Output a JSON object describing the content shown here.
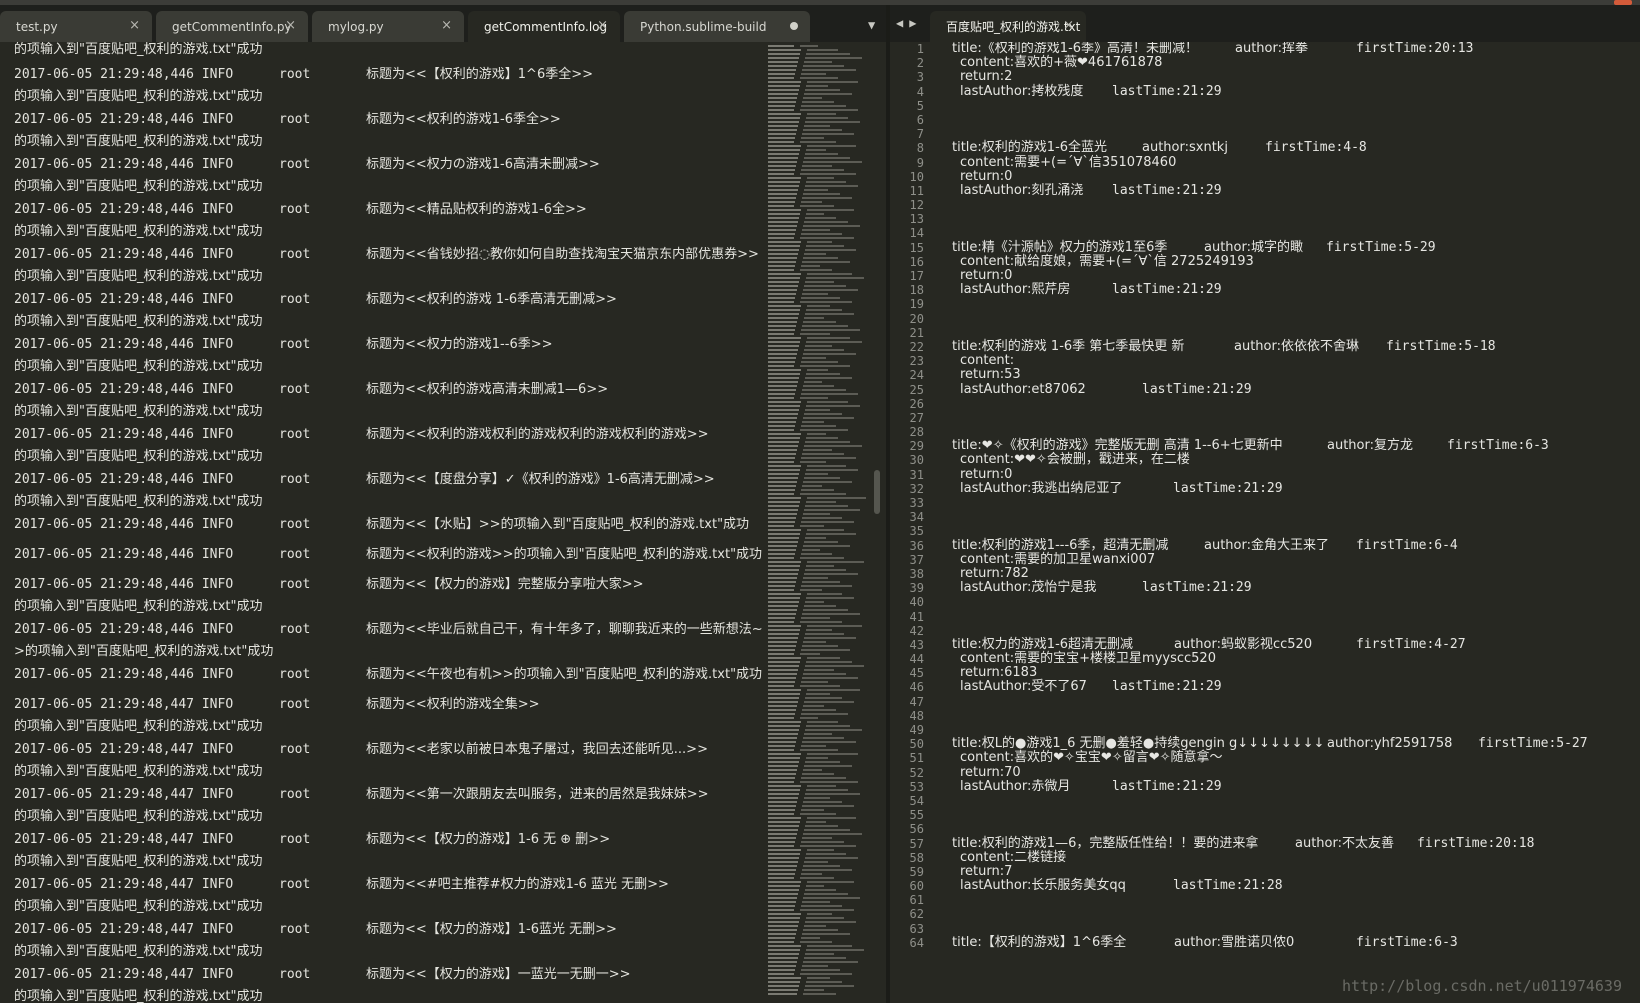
{
  "left_tabs": [
    {
      "label": "test.py",
      "state": "close"
    },
    {
      "label": "getCommentInfo.py",
      "state": "close"
    },
    {
      "label": "mylog.py",
      "state": "close"
    },
    {
      "label": "getCommentInfo.log",
      "state": "close",
      "active": true
    },
    {
      "label": "Python.sublime-build",
      "state": "dirty"
    }
  ],
  "right_tab": {
    "label": "百度贴吧_权利的游戏.txt"
  },
  "glyphs": {
    "close": "×",
    "dropdown": "▼",
    "nav": "◀▶"
  },
  "log_first_line": "的项输入到\"百度贴吧_权利的游戏.txt\"成功",
  "log_entries": [
    {
      "date": "2017-06-05 21:29:48,446 INFO",
      "user": "root",
      "msg": "标题为<<【权利的游戏】1^6季全>>",
      "cont": "的项输入到\"百度贴吧_权利的游戏.txt\"成功"
    },
    {
      "date": "2017-06-05 21:29:48,446 INFO",
      "user": "root",
      "msg": "标题为<<权利的游戏1-6季全>>",
      "cont": "的项输入到\"百度贴吧_权利的游戏.txt\"成功"
    },
    {
      "date": "2017-06-05 21:29:48,446 INFO",
      "user": "root",
      "msg": "标题为<<权力の游戏1-6高清未删减>>",
      "cont": "的项输入到\"百度贴吧_权利的游戏.txt\"成功"
    },
    {
      "date": "2017-06-05 21:29:48,446 INFO",
      "user": "root",
      "msg": "标题为<<精品贴权利的游戏1-6全>>",
      "cont": "的项输入到\"百度贴吧_权利的游戏.txt\"成功"
    },
    {
      "date": "2017-06-05 21:29:48,446 INFO",
      "user": "root",
      "msg": "标题为<<省钱妙招◌教你如何自助查找淘宝天猫京东内部优惠券>>",
      "cont": "的项输入到\"百度贴吧_权利的游戏.txt\"成功"
    },
    {
      "date": "2017-06-05 21:29:48,446 INFO",
      "user": "root",
      "msg": "标题为<<权利的游戏 1-6季高清无删减>>",
      "cont": "的项输入到\"百度贴吧_权利的游戏.txt\"成功"
    },
    {
      "date": "2017-06-05 21:29:48,446 INFO",
      "user": "root",
      "msg": "标题为<<权力的游戏1--6季>>",
      "cont": "的项输入到\"百度贴吧_权利的游戏.txt\"成功"
    },
    {
      "date": "2017-06-05 21:29:48,446 INFO",
      "user": "root",
      "msg": "标题为<<权利的游戏高清未删减1—6>>",
      "cont": "的项输入到\"百度贴吧_权利的游戏.txt\"成功"
    },
    {
      "date": "2017-06-05 21:29:48,446 INFO",
      "user": "root",
      "msg": "标题为<<权利的游戏权利的游戏权利的游戏权利的游戏>>",
      "cont": "的项输入到\"百度贴吧_权利的游戏.txt\"成功"
    },
    {
      "date": "2017-06-05 21:29:48,446 INFO",
      "user": "root",
      "msg": "标题为<<【度盘分享】✓《权利的游戏》1-6高清无删减>>",
      "cont": "的项输入到\"百度贴吧_权利的游戏.txt\"成功"
    },
    {
      "date": "2017-06-05 21:29:48,446 INFO",
      "user": "root",
      "msg": "标题为<<【水贴】>>的项输入到\"百度贴吧_权利的游戏.txt\"成功",
      "cont": ""
    },
    {
      "date": "2017-06-05 21:29:48,446 INFO",
      "user": "root",
      "msg": "标题为<<权利的游戏>>的项输入到\"百度贴吧_权利的游戏.txt\"成功",
      "cont": ""
    },
    {
      "date": "2017-06-05 21:29:48,446 INFO",
      "user": "root",
      "msg": "标题为<<【权力的游戏】完整版分享啦大家>>",
      "cont": "的项输入到\"百度贴吧_权利的游戏.txt\"成功"
    },
    {
      "date": "2017-06-05 21:29:48,446 INFO",
      "user": "root",
      "msg": "标题为<<毕业后就自己干，有十年多了，聊聊我近来的一些新想法~",
      "cont": ">的项输入到\"百度贴吧_权利的游戏.txt\"成功"
    },
    {
      "date": "2017-06-05 21:29:48,446 INFO",
      "user": "root",
      "msg": "标题为<<午夜也有机>>的项输入到\"百度贴吧_权利的游戏.txt\"成功",
      "cont": ""
    },
    {
      "date": "2017-06-05 21:29:48,447 INFO",
      "user": "root",
      "msg": "标题为<<权利的游戏全集>>",
      "cont": "的项输入到\"百度贴吧_权利的游戏.txt\"成功"
    },
    {
      "date": "2017-06-05 21:29:48,447 INFO",
      "user": "root",
      "msg": "标题为<<老家以前被日本鬼子屠过，我回去还能听见...>>",
      "cont": "的项输入到\"百度贴吧_权利的游戏.txt\"成功"
    },
    {
      "date": "2017-06-05 21:29:48,447 INFO",
      "user": "root",
      "msg": "标题为<<第一次跟朋友去叫服务，进来的居然是我妹妹>>",
      "cont": "的项输入到\"百度贴吧_权利的游戏.txt\"成功"
    },
    {
      "date": "2017-06-05 21:29:48,447 INFO",
      "user": "root",
      "msg": "标题为<<【权力的游戏】1-6  无 ⊕ 删>>",
      "cont": "的项输入到\"百度贴吧_权利的游戏.txt\"成功"
    },
    {
      "date": "2017-06-05 21:29:48,447 INFO",
      "user": "root",
      "msg": "标题为<<#吧主推荐#权力的游戏1-6 蓝光 无删>>",
      "cont": "的项输入到\"百度贴吧_权利的游戏.txt\"成功"
    },
    {
      "date": "2017-06-05 21:29:48,447 INFO",
      "user": "root",
      "msg": "标题为<<【权力的游戏】1-6蓝光 无删>>",
      "cont": "的项输入到\"百度贴吧_权利的游戏.txt\"成功"
    },
    {
      "date": "2017-06-05 21:29:48,447 INFO",
      "user": "root",
      "msg": "标题为<<【权力的游戏】一蓝光一无删一>>",
      "cont": "的项输入到\"百度贴吧_权利的游戏.txt\"成功"
    }
  ],
  "txt_lines": [
    {
      "n": "1",
      "title": "title:《权利的游戏1-6季》高清！未删减！",
      "author": "author:挥拳",
      "first": "firstTime:20:13"
    },
    {
      "n": "2",
      "content": "content:喜欢的+薇❤461761878"
    },
    {
      "n": "3",
      "content": "return:2"
    },
    {
      "n": "4",
      "la": "lastAuthor:拷枚残度",
      "lt": "lastTime:21:29"
    },
    {
      "n": "5"
    },
    {
      "n": "6"
    },
    {
      "n": "7"
    },
    {
      "n": "8",
      "title": "title:权利的游戏1-6全蓝光",
      "author": "author:sxntkj",
      "first": "firstTime:4-8"
    },
    {
      "n": "9",
      "content": "content:需要+(=´∀`信351078460"
    },
    {
      "n": "10",
      "content": "return:0"
    },
    {
      "n": "11",
      "la": "lastAuthor:刻孔涌浇",
      "lt": "lastTime:21:29"
    },
    {
      "n": "12"
    },
    {
      "n": "13"
    },
    {
      "n": "14"
    },
    {
      "n": "15",
      "title": "title:精《汁源帖》权力的游戏1至6季",
      "author": "author:城字的瞰",
      "first": "firstTime:5-29"
    },
    {
      "n": "16",
      "content": "content:献给度娘，需要+(=´∀`信 2725249193"
    },
    {
      "n": "17",
      "content": "return:0"
    },
    {
      "n": "18",
      "la": "lastAuthor:熙芹房",
      "lt": "lastTime:21:29"
    },
    {
      "n": "19"
    },
    {
      "n": "20"
    },
    {
      "n": "21"
    },
    {
      "n": "22",
      "title": "title:权利的游戏 1-6季 第七季最快更 新",
      "author": "author:依依依不舍琳",
      "first": "firstTime:5-18"
    },
    {
      "n": "23",
      "content": "content:"
    },
    {
      "n": "24",
      "content": "return:53"
    },
    {
      "n": "25",
      "la": "lastAuthor:et87062",
      "lt": "lastTime:21:29"
    },
    {
      "n": "26"
    },
    {
      "n": "27"
    },
    {
      "n": "28"
    },
    {
      "n": "29",
      "title": "title:❤✧《权利的游戏》完整版无删 高清 1--6+七更新中",
      "author": "author:复方龙",
      "first": "firstTime:6-3"
    },
    {
      "n": "30",
      "content": "content:❤❤✧会被删，戳进来，在二楼"
    },
    {
      "n": "31",
      "content": "return:0"
    },
    {
      "n": "32",
      "la": "lastAuthor:我逃出纳尼亚了",
      "lt": "lastTime:21:29"
    },
    {
      "n": "33"
    },
    {
      "n": "34"
    },
    {
      "n": "35"
    },
    {
      "n": "36",
      "title": "title:权利的游戏1---6季，超清无删减",
      "author": "author:金角大王来了",
      "first": "firstTime:6-4"
    },
    {
      "n": "37",
      "content": "content:需要的加卫星wanxi007"
    },
    {
      "n": "38",
      "content": "return:782"
    },
    {
      "n": "39",
      "la": "lastAuthor:茂怡宁是我",
      "lt": "lastTime:21:29"
    },
    {
      "n": "40"
    },
    {
      "n": "41"
    },
    {
      "n": "42"
    },
    {
      "n": "43",
      "title": "title:权力的游戏1-6超清无删减",
      "author": "author:蚂蚁影视cc520",
      "first": "firstTime:4-27"
    },
    {
      "n": "44",
      "content": "content:需要的宝宝+楼楼卫星myyscc520"
    },
    {
      "n": "45",
      "content": "return:6183"
    },
    {
      "n": "46",
      "la": "lastAuthor:受不了67",
      "lt": "lastTime:21:29"
    },
    {
      "n": "47"
    },
    {
      "n": "48"
    },
    {
      "n": "49"
    },
    {
      "n": "50",
      "title": "title:权L的●游戏1_6 无删●羞轻●持续gengin g↓↓↓↓↓↓↓↓",
      "author": "author:yhf2591758",
      "first": "firstTime:5-27"
    },
    {
      "n": "51",
      "content": "content:喜欢的❤✧宝宝❤✧留言❤✧随意拿～"
    },
    {
      "n": "52",
      "content": "return:70"
    },
    {
      "n": "53",
      "la": "lastAuthor:赤微月",
      "lt": "lastTime:21:29"
    },
    {
      "n": "54"
    },
    {
      "n": "55"
    },
    {
      "n": "56"
    },
    {
      "n": "57",
      "title": "title:权利的游戏1—6，完整版任性给！！要的进来拿",
      "author": "author:不太友善",
      "first": "firstTime:20:18"
    },
    {
      "n": "58",
      "content": "content:二楼链接"
    },
    {
      "n": "59",
      "content": "return:7"
    },
    {
      "n": "60",
      "la": "lastAuthor:长乐服务美女qq",
      "lt": "lastTime:21:28"
    },
    {
      "n": "61"
    },
    {
      "n": "62"
    },
    {
      "n": "63"
    },
    {
      "n": "64",
      "title": "title:【权利的游戏】1^6季全",
      "author": "author:雪胜诺贝侬0",
      "first": "firstTime:6-3"
    }
  ],
  "watermark": "http://blog.csdn.net/u011974639"
}
